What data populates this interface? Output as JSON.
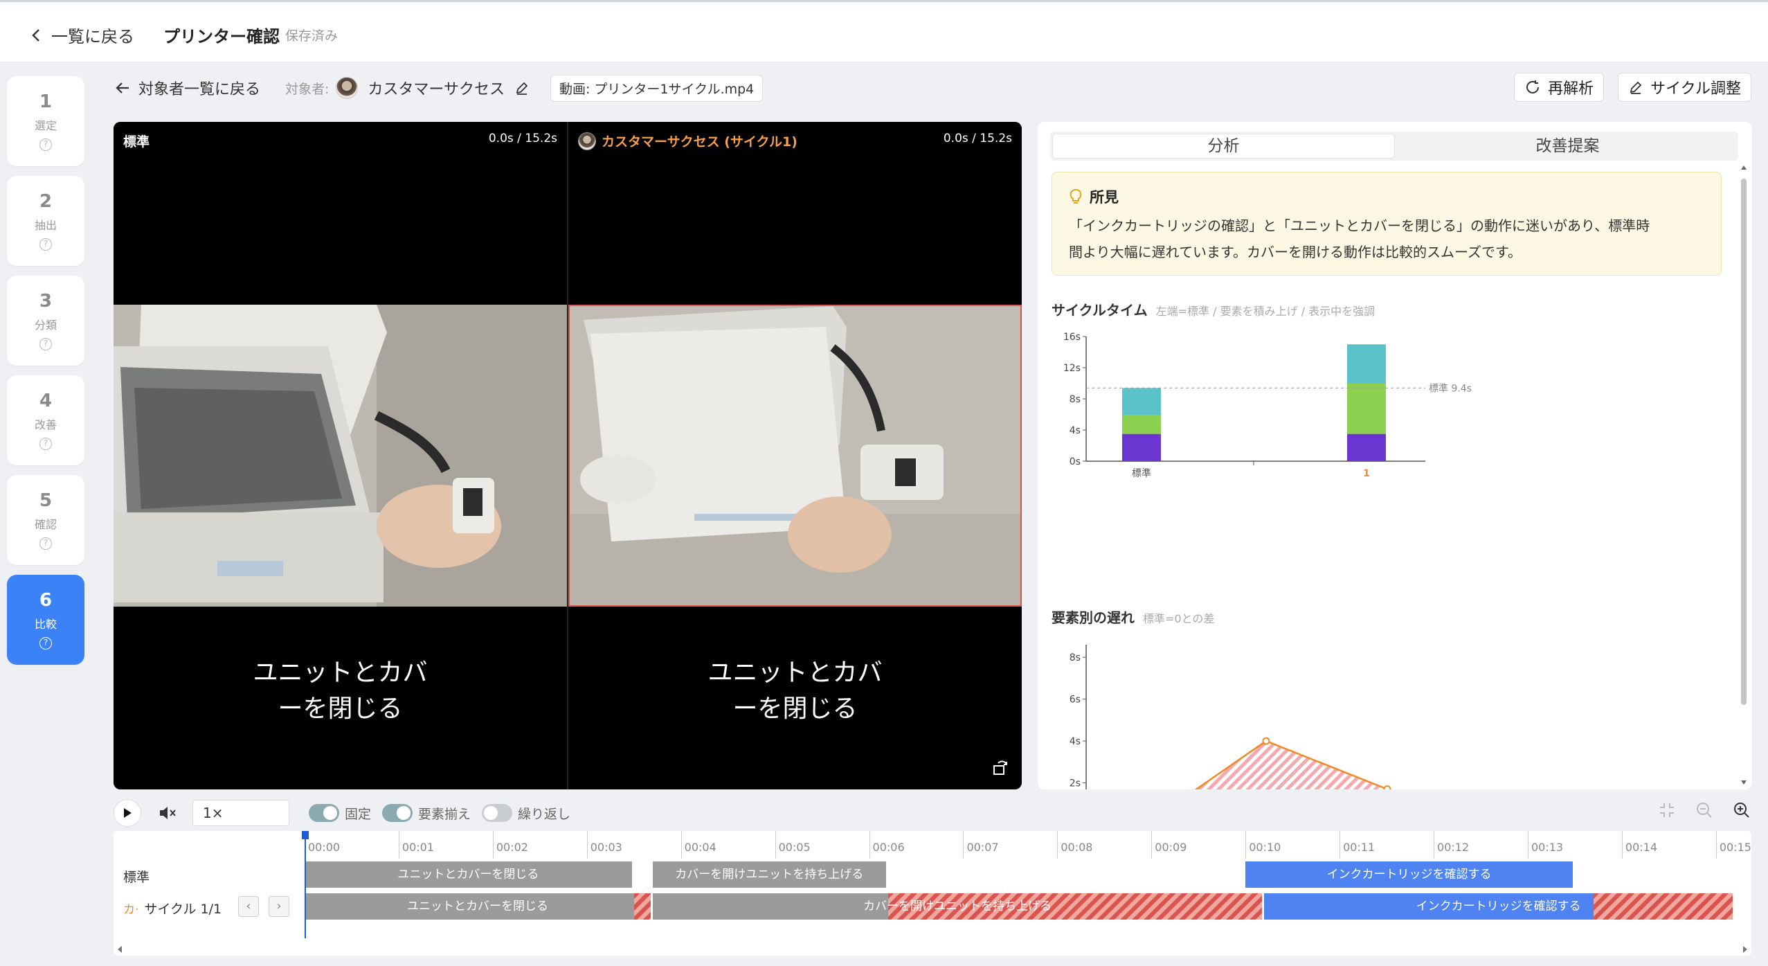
{
  "header": {
    "back_label": "一覧に戻る",
    "title": "プリンター確認",
    "saved": "保存済み"
  },
  "steps": [
    {
      "num": "1",
      "label": "選定"
    },
    {
      "num": "2",
      "label": "抽出"
    },
    {
      "num": "3",
      "label": "分類"
    },
    {
      "num": "4",
      "label": "改善"
    },
    {
      "num": "5",
      "label": "確認"
    },
    {
      "num": "6",
      "label": "比較"
    }
  ],
  "active_step": "6",
  "subheader": {
    "back_label": "対象者一覧に戻る",
    "target_label": "対象者:",
    "target_name": "カスタマーサクセス",
    "video_label": "動画: プリンター1サイクル.mp4"
  },
  "actions": {
    "reanalyze": "再解析",
    "cycle_adjust": "サイクル調整"
  },
  "video": {
    "left_title": "標準",
    "left_time": "0.0s / 15.2s",
    "right_title": "カスタマーサクセス (サイクル1)",
    "right_time": "0.0s / 15.2s",
    "left_caption_1": "ユニットとカバ",
    "left_caption_2": "ーを閉じる",
    "right_caption_1": "ユニットとカバ",
    "right_caption_2": "ーを閉じる"
  },
  "panel": {
    "tabs": [
      "分析",
      "改善提案"
    ],
    "finding_title": "所見",
    "finding_text_1": "「インクカートリッジの確認」と「ユニットとカバーを閉じる」の動作に迷いがあり、標準時",
    "finding_text_2": "間より大幅に遅れています。カバーを開ける動作は比較的スムーズです。",
    "cycle_title": "サイクルタイム",
    "cycle_hint": "左端=標準 / 要素を積み上げ / 表示中を強調",
    "delay_title": "要素別の遅れ",
    "delay_hint": "標準=0との差",
    "standard_line_label": "標準 9.4s"
  },
  "chart_data": [
    {
      "type": "bar",
      "title": "サイクルタイム",
      "categories": [
        "標準",
        "1"
      ],
      "yticks": [
        "0s",
        "4s",
        "8s",
        "12s",
        "16s"
      ],
      "ylim": [
        0,
        16
      ],
      "series": [
        {
          "values": [
            3.5,
            3.5
          ],
          "color": "#6a35d1"
        },
        {
          "values": [
            2.4,
            6.5
          ],
          "color": "#8bd04f"
        },
        {
          "values": [
            3.5,
            5.0
          ],
          "color": "#5ac2c8"
        }
      ],
      "reference_line": 9.4,
      "highlight_category": "1",
      "highlight_color": "#f08a24"
    },
    {
      "type": "area",
      "title": "要素別の遅れ",
      "yticks": [
        "2s",
        "4s",
        "6s",
        "8s"
      ],
      "ylim": [
        0,
        8.6
      ],
      "x": [
        0,
        1,
        2
      ],
      "values": [
        0,
        4.0,
        1.7
      ],
      "color": "#f08a24"
    }
  ],
  "controls": {
    "speed": "1×",
    "toggle_fixed": "固定",
    "toggle_align": "要素揃え",
    "toggle_repeat": "繰り返し"
  },
  "timeline": {
    "ticks": [
      "00:00",
      "00:01",
      "00:02",
      "00:03",
      "00:04",
      "00:05",
      "00:06",
      "00:07",
      "00:08",
      "00:09",
      "00:10",
      "00:11",
      "00:12",
      "00:13",
      "00:14",
      "00:15"
    ],
    "row_standard": "標準",
    "row_cycle_prefix": "カ·",
    "row_cycle": "サイクル 1/1",
    "standard_segments": [
      {
        "label": "ユニットとカバーを閉じる",
        "start": 0,
        "end": 3.5,
        "kind": "gray"
      },
      {
        "label": "カバーを開けユニットを持ち上げる",
        "start": 3.7,
        "end": 6.2,
        "kind": "gray"
      },
      {
        "label": "インクカートリッジを確認する",
        "start": 10.0,
        "end": 13.5,
        "kind": "blue"
      }
    ],
    "cycle_segments": [
      {
        "label": "ユニットとカバーを閉じる",
        "start": 0,
        "end": 3.7,
        "hatch_from": 3.5,
        "kind": "gray"
      },
      {
        "label": "カバーを開けユニットを持ち上げる",
        "start": 3.7,
        "end": 10.2,
        "hatch_from": 6.2,
        "kind": "gray"
      },
      {
        "label": "インクカートリッジを確認する",
        "start": 10.2,
        "end": 15.2,
        "hatch_from": 13.7,
        "kind": "blue"
      }
    ]
  }
}
